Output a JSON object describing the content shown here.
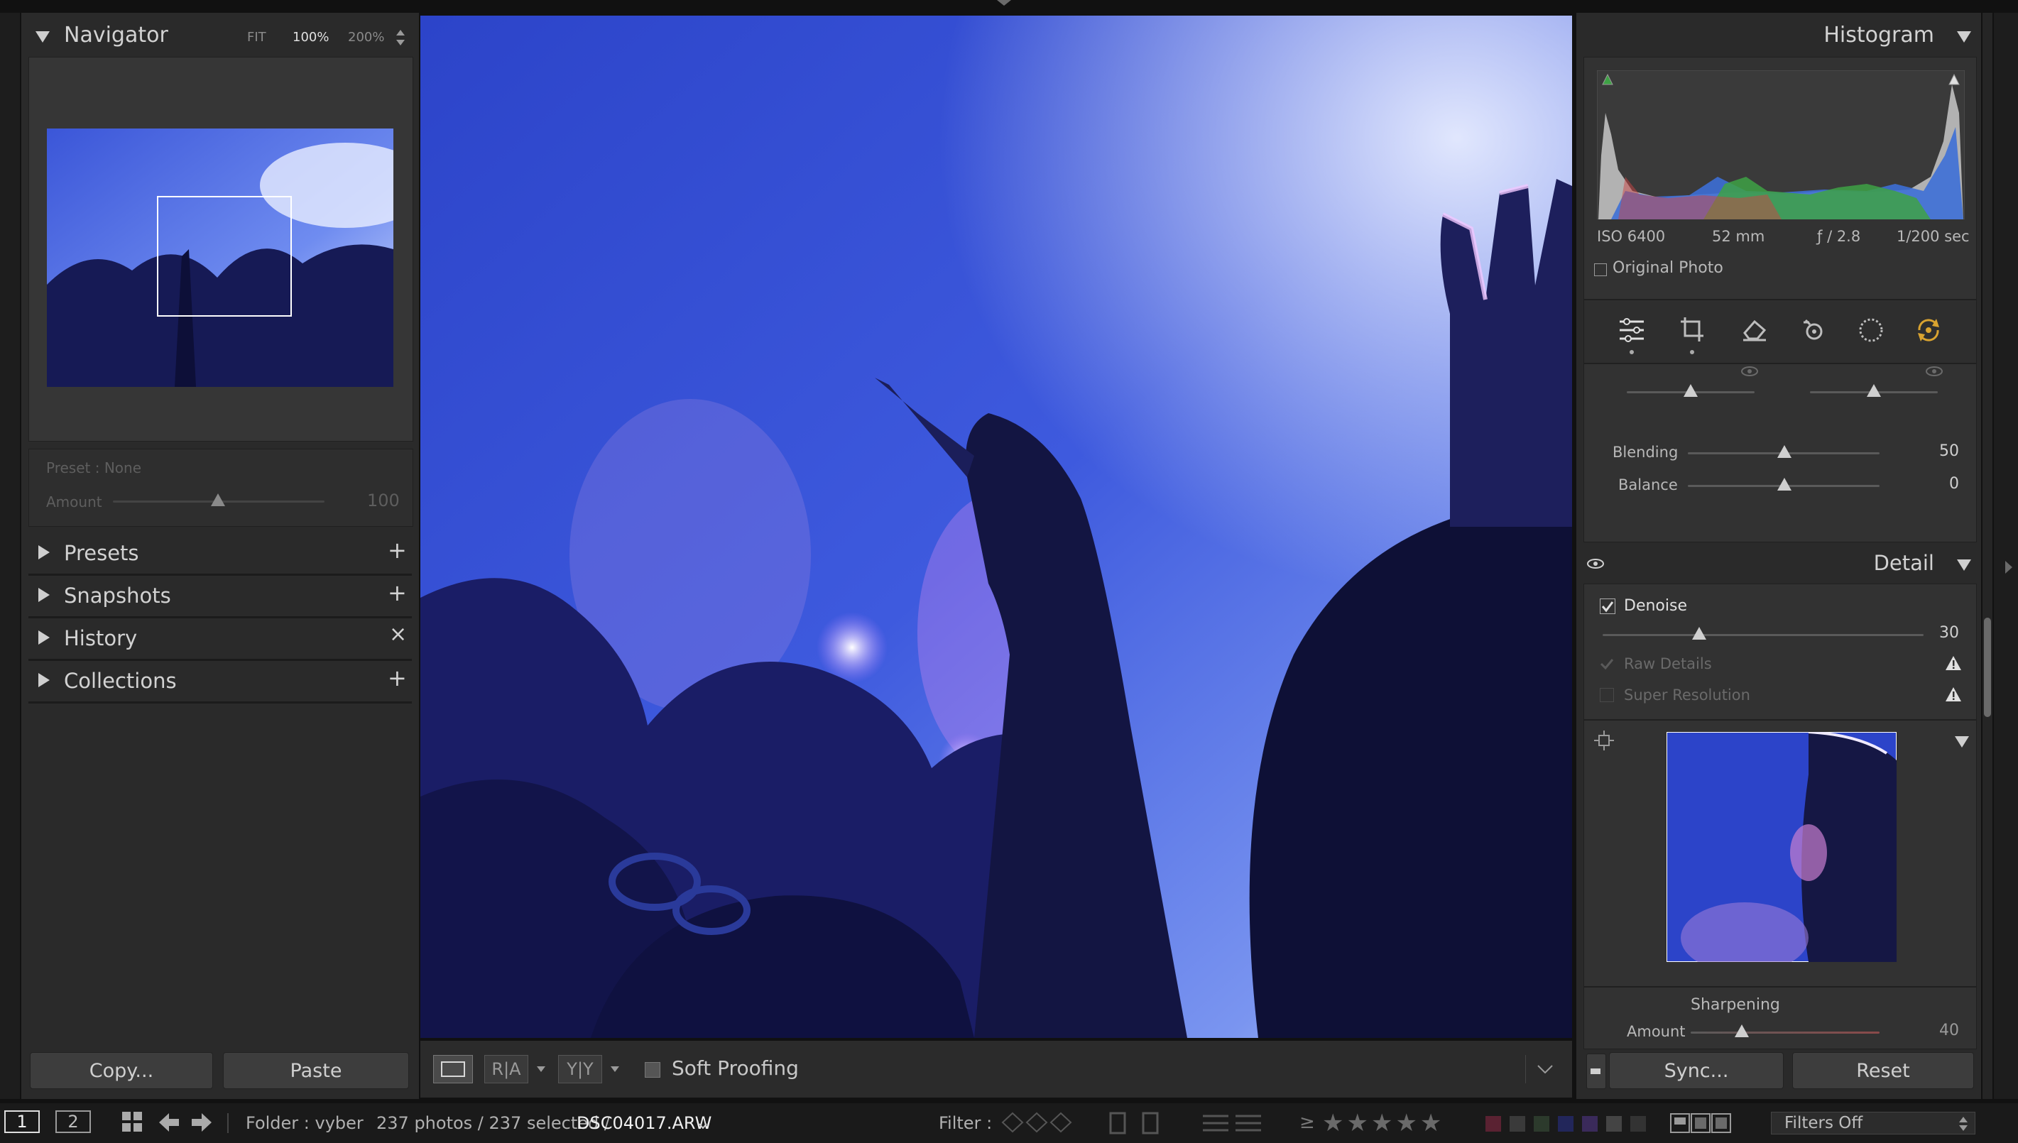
{
  "left": {
    "navigator": {
      "title": "Navigator",
      "fit": "FIT",
      "zoom100": "100%",
      "zoom200": "200%"
    },
    "preset": {
      "label": "Preset : None",
      "amount_label": "Amount",
      "amount_value": "100",
      "amount_fraction": 0.5
    },
    "sections": [
      {
        "label": "Presets",
        "action": "+"
      },
      {
        "label": "Snapshots",
        "action": "+"
      },
      {
        "label": "History",
        "action": "×"
      },
      {
        "label": "Collections",
        "action": "+"
      }
    ],
    "copy_label": "Copy...",
    "paste_label": "Paste"
  },
  "toolbar": {
    "soft_proofing": "Soft Proofing",
    "view_ra": "R|A",
    "view_yy": "Y|Y"
  },
  "right": {
    "histogram": {
      "title": "Histogram",
      "iso": "ISO 6400",
      "focal": "52 mm",
      "aperture": "ƒ / 2.8",
      "shutter": "1/200 sec",
      "original_photo": "Original Photo"
    },
    "blending": {
      "label": "Blending",
      "value": "50",
      "fraction": 0.5
    },
    "balance": {
      "label": "Balance",
      "value": "0",
      "fraction": 0.5
    },
    "detail": {
      "title": "Detail",
      "denoise_label": "Denoise",
      "denoise_value": "30",
      "denoise_fraction": 0.3,
      "raw_details": "Raw Details",
      "super_resolution": "Super Resolution",
      "sharpening_title": "Sharpening",
      "amount_label": "Amount",
      "amount_value": "40",
      "amount_fraction": 0.27
    },
    "sync_label": "Sync...",
    "reset_label": "Reset"
  },
  "filmstrip": {
    "screen1": "1",
    "screen2": "2",
    "folder": "Folder : vyber",
    "count": "237 photos / 237 selected /",
    "filename": "DSC04017.ARW",
    "filter_label": "Filter :",
    "rating_prefix": "≥",
    "stars": "★★★★★",
    "filters_off": "Filters Off"
  },
  "colors": {
    "accent": "#3a55d8",
    "photo_deep": "#1c1f6a"
  }
}
